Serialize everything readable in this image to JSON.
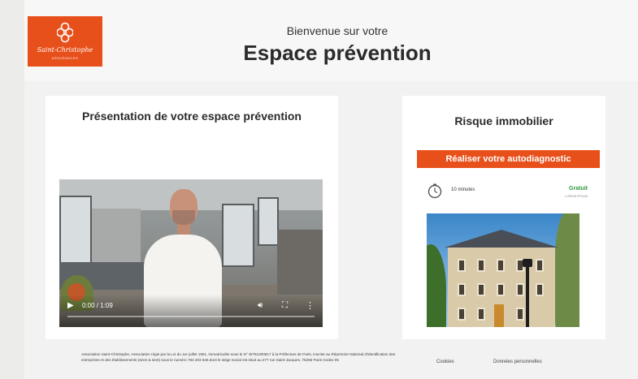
{
  "header": {
    "logo_name": "Saint-Christophe",
    "logo_sub": "ASSURANCES",
    "welcome": "Bienvenue sur votre",
    "title": "Espace prévention"
  },
  "presentation": {
    "title": "Présentation de votre espace prévention",
    "video": {
      "time": "0:00 / 1:09"
    }
  },
  "risk_card": {
    "title": "Risque immobilier",
    "cta_label": "Réaliser votre autodiagnostic",
    "duration": "10 minutes",
    "price": "Gratuit",
    "price_sub": "LOREM IPSUM"
  },
  "footer": {
    "legal": "Association Saint-Christophe, Association régie par la Loi du 1er juillet 1901, immatriculée sous le N° W751000817 à la Préfecture de Paris, inscrite au Répertoire National d'Identification des entreprises et des établissements (siren & siret) sous le numéro 784 203 546 dont le siège social est situé au 277 rue Saint-Jacques, 75256 Paris Cedex 05",
    "links": [
      "Cookies",
      "Données personnelles"
    ]
  },
  "colors": {
    "brand": "#e8501b",
    "accent_green": "#2e9a3a"
  }
}
